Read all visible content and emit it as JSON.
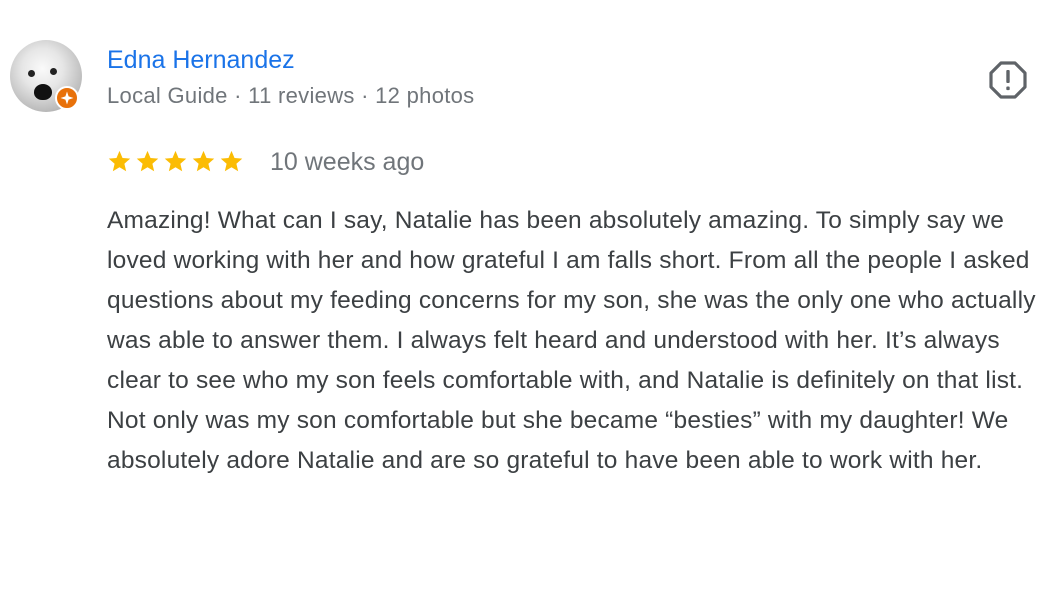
{
  "author": {
    "name": "Edna Hernandez",
    "meta": "Local Guide · 11 reviews · 12 photos"
  },
  "icons": {
    "avatar": "avatar-dog-photo",
    "badge": "local-guide-badge-icon",
    "report": "report-flag-icon",
    "star": "star-icon"
  },
  "review": {
    "rating": 5,
    "max_rating": 5,
    "date": "10 weeks ago",
    "text": "Amazing! What can I say, Natalie has been absolutely amazing. To simply say we loved working with her and how grateful I am falls short. From all the people I asked questions about my feeding concerns for my son, she was the only one who actually was able to answer them. I always felt heard and understood with her. It’s always clear to see who my son feels comfortable with, and Natalie is definitely on that list. Not only was my son comfortable but she became “besties” with my daughter! We absolutely adore Natalie and are so grateful to have been able to work with her."
  },
  "colors": {
    "name_link": "#1a73e8",
    "star": "#fbbc04",
    "meta_text": "#70757a",
    "body_text": "#3c4043",
    "badge": "#e8710a",
    "report_icon": "#5f6368"
  }
}
